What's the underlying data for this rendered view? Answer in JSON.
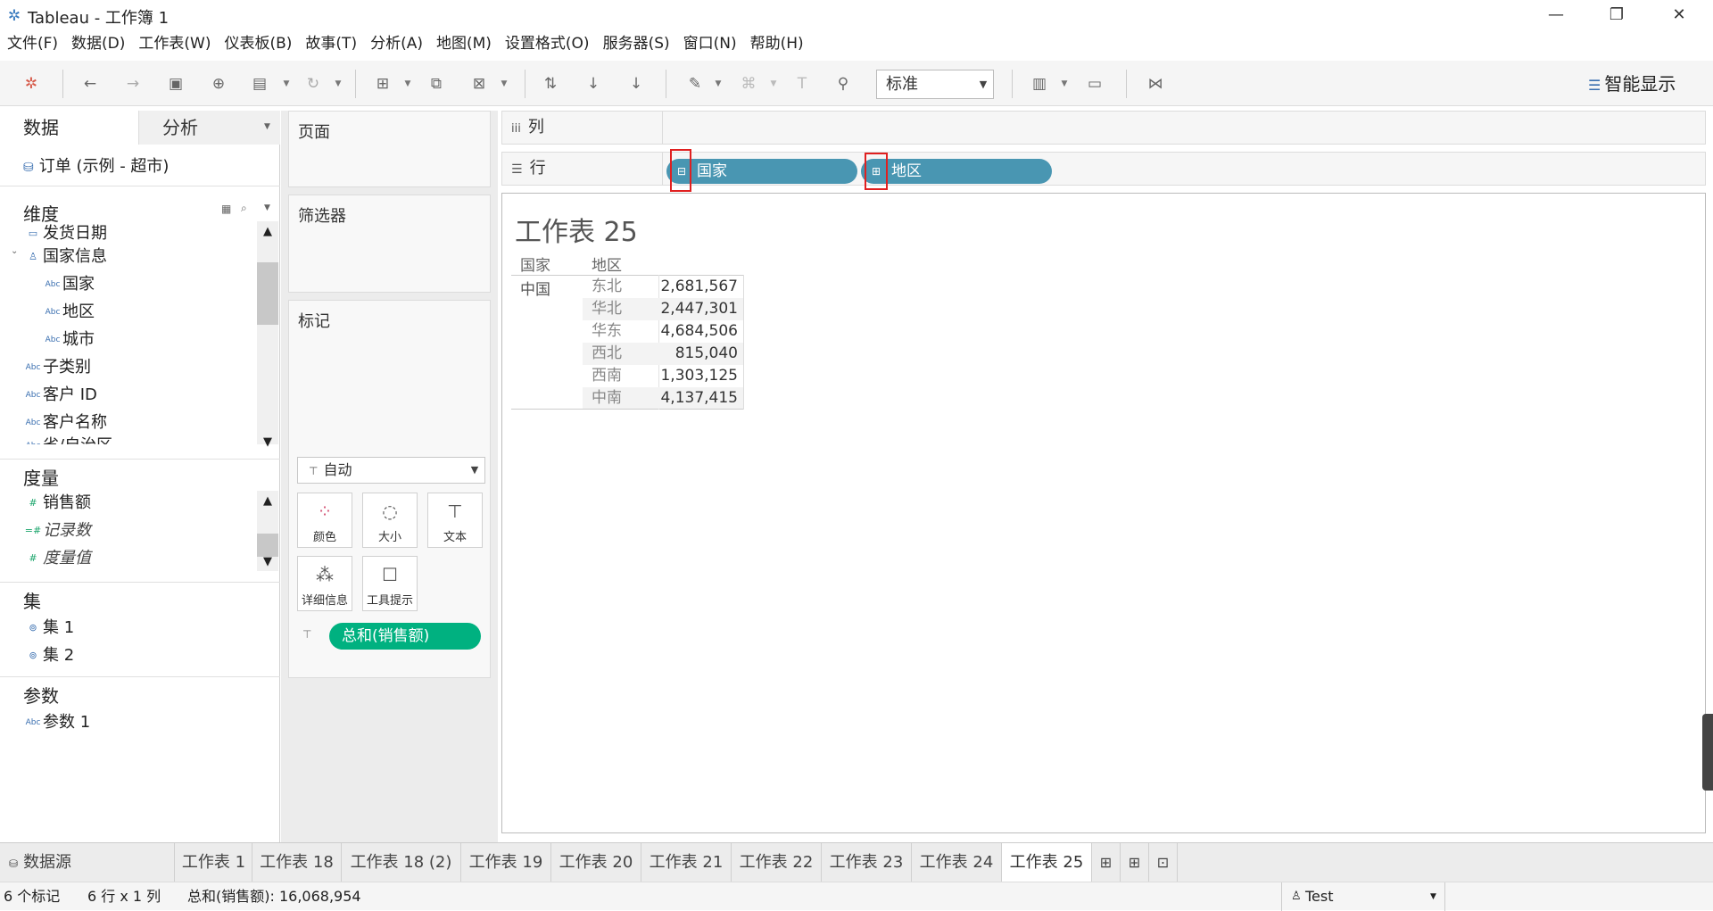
{
  "window": {
    "title": "Tableau - 工作簿 1"
  },
  "menu": [
    "文件(F)",
    "数据(D)",
    "工作表(W)",
    "仪表板(B)",
    "故事(T)",
    "分析(A)",
    "地图(M)",
    "设置格式(O)",
    "服务器(S)",
    "窗口(N)",
    "帮助(H)"
  ],
  "toolbar": {
    "fit": "标准",
    "show_me": "智能显示"
  },
  "data_pane": {
    "tabs": [
      "数据",
      "分析"
    ],
    "datasource": "订单 (示例 - 超市)",
    "dimensions_title": "维度",
    "dimensions": [
      {
        "icon": "date-icon",
        "label": "发货日期"
      },
      {
        "icon": "hierarchy-icon",
        "label": "国家信息"
      },
      {
        "icon": "abc-icon",
        "label": "国家"
      },
      {
        "icon": "abc-icon",
        "label": "地区"
      },
      {
        "icon": "abc-icon",
        "label": "城市"
      },
      {
        "icon": "abc-icon",
        "label": "子类别"
      },
      {
        "icon": "abc-icon",
        "label": "客户 ID"
      },
      {
        "icon": "abc-icon",
        "label": "客户名称"
      },
      {
        "icon": "abc-icon",
        "label": "省/自治区"
      }
    ],
    "measures_title": "度量",
    "measures": [
      {
        "icon": "number-icon",
        "label": "销售额"
      },
      {
        "icon": "number-icon",
        "label": "记录数"
      },
      {
        "icon": "number-icon",
        "label": "度量值"
      }
    ],
    "sets_title": "集",
    "sets": [
      "集 1",
      "集 2"
    ],
    "params_title": "参数",
    "params": [
      "参数 1"
    ]
  },
  "cards": {
    "pages": "页面",
    "filters": "筛选器",
    "marks": "标记",
    "mark_type": "自动",
    "mark_buttons": [
      "颜色",
      "大小",
      "文本",
      "详细信息",
      "工具提示"
    ],
    "mark_pill": "总和(销售额)"
  },
  "shelves": {
    "columns_label": "列",
    "rows_label": "行",
    "row_pills": [
      "国家",
      "地区"
    ]
  },
  "view": {
    "title": "工作表 25",
    "headers": [
      "国家",
      "地区"
    ],
    "country": "中国",
    "rows": [
      {
        "region": "东北",
        "value": "2,681,567"
      },
      {
        "region": "华北",
        "value": "2,447,301"
      },
      {
        "region": "华东",
        "value": "4,684,506"
      },
      {
        "region": "西北",
        "value": "815,040"
      },
      {
        "region": "西南",
        "value": "1,303,125"
      },
      {
        "region": "中南",
        "value": "4,137,415"
      }
    ]
  },
  "tabs": {
    "datasource": "数据源",
    "sheets": [
      "工作表 1",
      "工作表 18",
      "工作表 18 (2)",
      "工作表 19",
      "工作表 20",
      "工作表 21",
      "工作表 22",
      "工作表 23",
      "工作表 24",
      "工作表 25"
    ],
    "active": "工作表 25"
  },
  "status": {
    "marks": "6 个标记",
    "dims": "6 行 x 1 列",
    "sum": "总和(销售额): 16,068,954",
    "user": "Test"
  },
  "colors": {
    "pill_dimension": "#4996b2",
    "pill_measure": "#00b180",
    "highlight": "#e02020"
  }
}
